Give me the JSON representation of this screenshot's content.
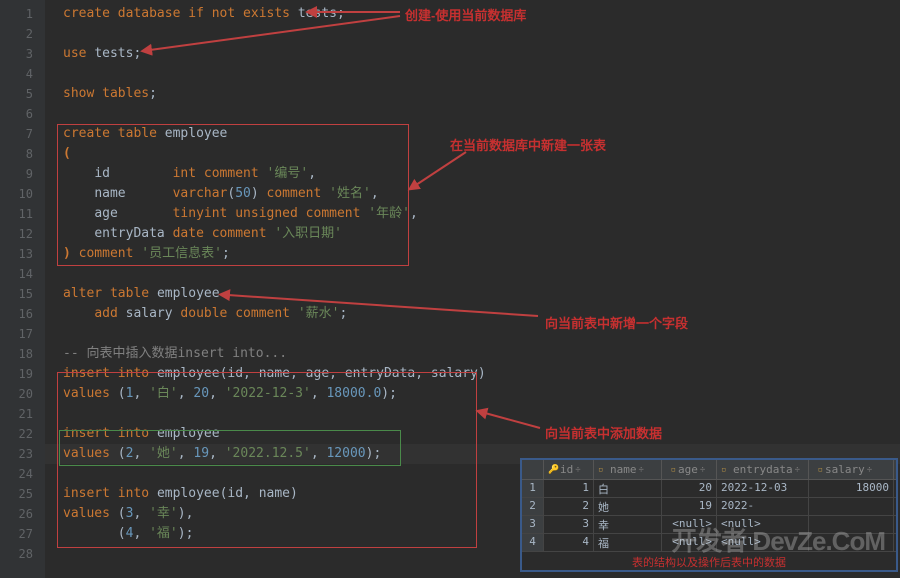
{
  "gutter_lines": [
    "1",
    "2",
    "3",
    "4",
    "5",
    "6",
    "7",
    "8",
    "9",
    "10",
    "11",
    "12",
    "13",
    "14",
    "15",
    "16",
    "17",
    "18",
    "19",
    "20",
    "21",
    "22",
    "23",
    "24",
    "25",
    "26",
    "27",
    "28"
  ],
  "annotations": {
    "a1": "创建-使用当前数据库",
    "a2": "在当前数据库中新建一张表",
    "a3": "向当前表中新增一个字段",
    "a4": "向当前表中添加数据",
    "footer": "表的结构以及操作后表中的数据"
  },
  "code": {
    "l1": {
      "t1": "create",
      "t2": "database",
      "t3": "if",
      "t4": "not",
      "t5": "exists",
      "t6": "tests",
      "t7": ";"
    },
    "l3": {
      "t1": "use",
      "t2": "tests",
      "t3": ";"
    },
    "l5": {
      "t1": "show",
      "t2": "tables",
      "t3": ";"
    },
    "l7": {
      "t1": "create",
      "t2": "table",
      "t3": "employee"
    },
    "l8": {
      "t1": "("
    },
    "l9": {
      "t1": "id",
      "t2": "int",
      "t3": "comment",
      "t4": "'编号'",
      "t5": ","
    },
    "l10": {
      "t1": "name",
      "t2": "varchar",
      "t3": "(",
      "t4": "50",
      "t5": ")",
      "t6": "comment",
      "t7": "'姓名'",
      "t8": ","
    },
    "l11": {
      "t1": "age",
      "t2": "tinyint",
      "t3": "unsigned",
      "t4": "comment",
      "t5": "'年龄'",
      "t6": ","
    },
    "l12": {
      "t1": "entryData",
      "t2": "date",
      "t3": "comment",
      "t4": "'入职日期'"
    },
    "l13": {
      "t1": ")",
      "t2": "comment",
      "t3": "'员工信息表'",
      "t4": ";"
    },
    "l15": {
      "t1": "alter",
      "t2": "table",
      "t3": "employee"
    },
    "l16": {
      "t1": "add",
      "t2": "salary",
      "t3": "double",
      "t4": "comment",
      "t5": "'薪水'",
      "t6": ";"
    },
    "l18": {
      "t1": "-- 向表中插入数据insert into..."
    },
    "l19": {
      "t1": "insert",
      "t2": "into",
      "t3": "employee",
      "t4": "(",
      "t5": "id",
      "t6": ",",
      "t7": "name",
      "t8": ",",
      "t9": "age",
      "t10": ",",
      "t11": "entryData",
      "t12": ",",
      "t13": "salary",
      "t14": ")"
    },
    "l20": {
      "t1": "values",
      "t2": "(",
      "t3": "1",
      "t4": ",",
      "t5": "'白'",
      "t6": ",",
      "t7": "20",
      "t8": ",",
      "t9": "'2022-12-3'",
      "t10": ",",
      "t11": "18000.0",
      "t12": ")",
      "t13": ";"
    },
    "l22": {
      "t1": "insert",
      "t2": "into",
      "t3": "employee"
    },
    "l23": {
      "t1": "values",
      "t2": "(",
      "t3": "2",
      "t4": ",",
      "t5": "'她'",
      "t6": ",",
      "t7": "19",
      "t8": ",",
      "t9": "'2022.12.5'",
      "t10": ",",
      "t11": "12000",
      "t12": ")",
      "t13": ";"
    },
    "l25": {
      "t1": "insert",
      "t2": "into",
      "t3": "employee",
      "t4": "(",
      "t5": "id",
      "t6": ",",
      "t7": "name",
      "t8": ")"
    },
    "l26": {
      "t1": "values",
      "t2": "(",
      "t3": "3",
      "t4": ",",
      "t5": "'幸'",
      "t6": ")",
      "t7": ","
    },
    "l27": {
      "t1": "(",
      "t2": "4",
      "t3": ",",
      "t4": "'福'",
      "t5": ")",
      "t6": ";"
    }
  },
  "result": {
    "headers": {
      "id": "id",
      "name": "name",
      "age": "age",
      "entry": "entrydata",
      "salary": "salary"
    },
    "rows": [
      {
        "n": "1",
        "id": "1",
        "name": "白",
        "age": "20",
        "entry": "2022-12-03",
        "salary": "18000"
      },
      {
        "n": "2",
        "id": "2",
        "name": "她",
        "age": "19",
        "entry": "2022-",
        "salary": ""
      },
      {
        "n": "3",
        "id": "3",
        "name": "幸",
        "age": "<null>",
        "entry": "<null>",
        "salary": ""
      },
      {
        "n": "4",
        "id": "4",
        "name": "福",
        "age": "<null>",
        "entry": "<null>",
        "salary": ""
      }
    ]
  },
  "watermark": "开发者 DevZe.CoM"
}
